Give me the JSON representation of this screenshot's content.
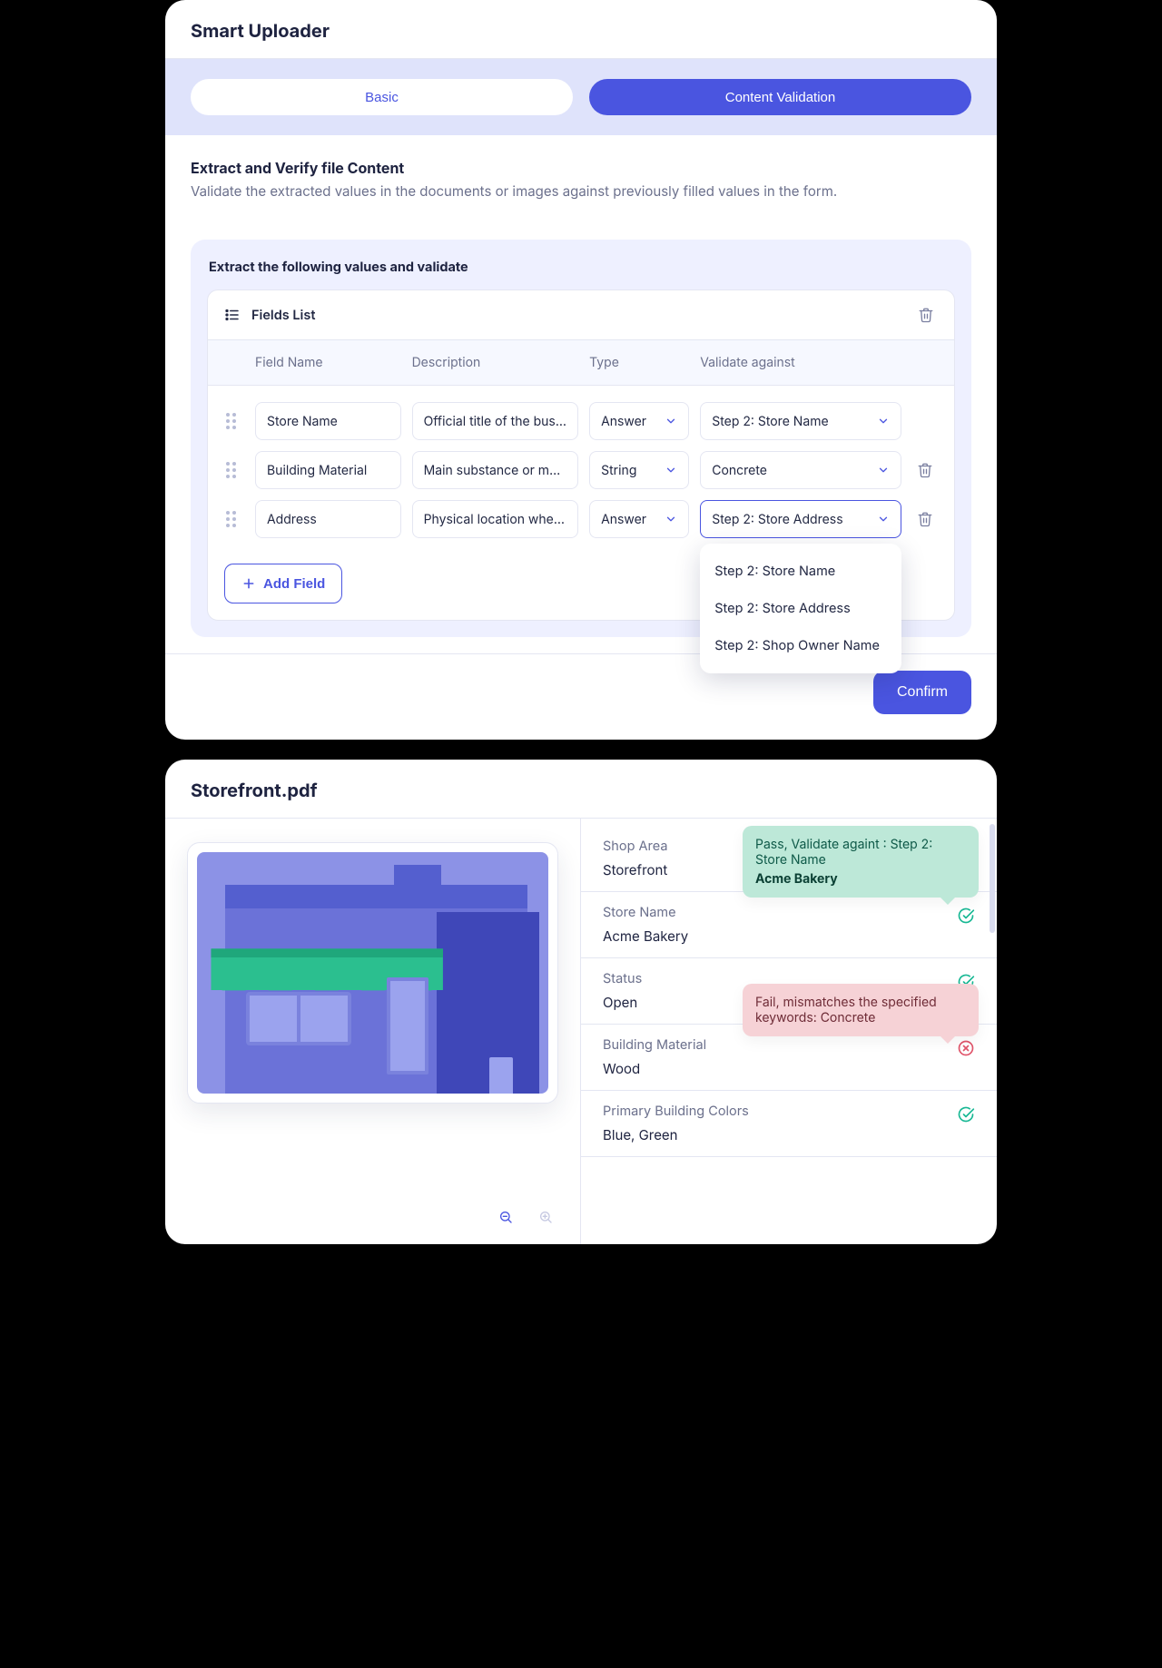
{
  "uploader": {
    "title": "Smart Uploader",
    "tabs": {
      "basic": "Basic",
      "validation": "Content Validation",
      "active": "validation"
    },
    "section_title": "Extract and Verify file Content",
    "section_desc": "Validate the extracted values in the documents or images against previously filled values in the form.",
    "panel_title": "Extract the following values and validate",
    "fields_list_label": "Fields List",
    "columns": {
      "name": "Field Name",
      "desc": "Description",
      "type": "Type",
      "validate": "Validate against"
    },
    "rows": [
      {
        "name": "Store Name",
        "desc": "Official title of the busi…",
        "type": "Answer",
        "validate": "Step 2: Store Name",
        "deletable": false
      },
      {
        "name": "Building Material",
        "desc": "Main substance or mat…",
        "type": "String",
        "validate": "Concrete",
        "deletable": true
      },
      {
        "name": "Address",
        "desc": "Physical location where…",
        "type": "Answer",
        "validate": "Step 2: Store Address",
        "deletable": true,
        "open": true
      }
    ],
    "validate_options": [
      "Step 2: Store Name",
      "Step 2: Store Address",
      "Step 2: Shop Owner Name"
    ],
    "add_field": "Add Field",
    "confirm": "Confirm"
  },
  "doc": {
    "title": "Storefront.pdf",
    "results": [
      {
        "label": "Shop Area",
        "value": "Storefront",
        "status": "none"
      },
      {
        "label": "Store Name",
        "value": "Acme Bakery",
        "status": "ok"
      },
      {
        "label": "Status",
        "value": "Open",
        "status": "ok"
      },
      {
        "label": "Building Material",
        "value": "Wood",
        "status": "bad"
      },
      {
        "label": "Primary Building Colors",
        "value": "Blue, Green",
        "status": "ok"
      }
    ],
    "pass_callout": {
      "text": "Pass, Validate againt : Step 2: Store Name",
      "highlight": "Acme Bakery"
    },
    "fail_callout": {
      "text": "Fail, mismatches the specified keywords: Concrete"
    }
  },
  "icons": {
    "list": "list-icon",
    "trash": "trash-icon",
    "chevron": "chevron-down-icon",
    "plus": "plus-icon",
    "check": "check-circle-icon",
    "fail": "x-circle-icon",
    "zoom_out": "zoom-out-icon",
    "zoom_in": "zoom-in-icon"
  },
  "colors": {
    "primary": "#4a55e0",
    "ok": "#18b894",
    "bad": "#e0546a"
  }
}
